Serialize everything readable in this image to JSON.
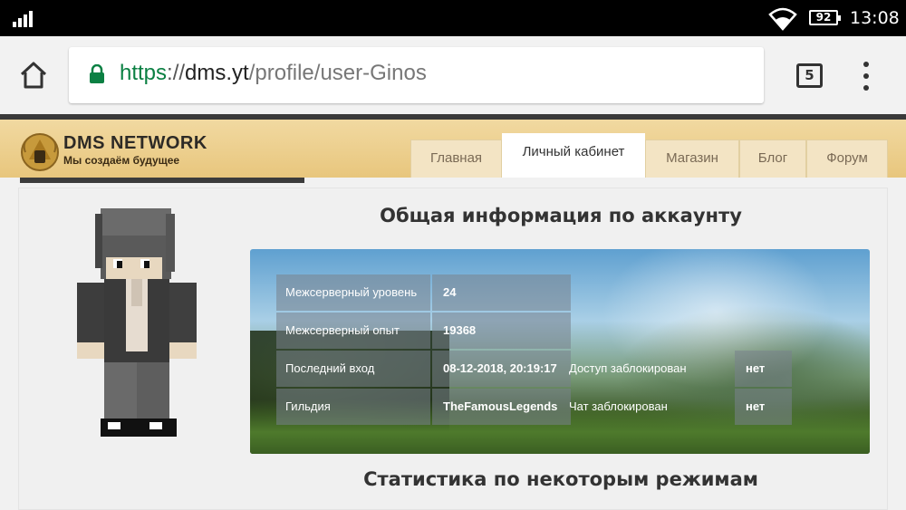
{
  "status_bar": {
    "battery": "92",
    "time": "13:08"
  },
  "browser": {
    "url_scheme": "https",
    "url_sep": "://",
    "url_host": "dms.yt",
    "url_path": "/profile/user-Ginos",
    "tab_count": "5"
  },
  "site": {
    "logo_title": "DMS NETWORK",
    "logo_subtitle": "Мы создаём будущее",
    "nav": [
      {
        "label": "Главная",
        "active": false
      },
      {
        "label": "Личный кабинет",
        "active": true
      },
      {
        "label": "Магазин",
        "active": false
      },
      {
        "label": "Блог",
        "active": false
      },
      {
        "label": "Форум",
        "active": false
      }
    ]
  },
  "profile": {
    "account_title": "Общая информация по аккаунту",
    "stats_title": "Статистика по некоторым режимам",
    "rows": [
      {
        "label": "Межсерверный уровень",
        "value": "24"
      },
      {
        "label": "Межсерверный опыт",
        "value": "19368"
      },
      {
        "label": "Последний вход",
        "value": "08-12-2018, 20:19:17",
        "extra_label": "Доступ заблокирован",
        "extra_value": "нет"
      },
      {
        "label": "Гильдия",
        "value": "TheFamousLegends",
        "extra_label": "Чат заблокирован",
        "extra_value": "нет"
      }
    ]
  },
  "colors": {
    "url_scheme": "#0b8043",
    "header_gold": "#e8c67d"
  }
}
